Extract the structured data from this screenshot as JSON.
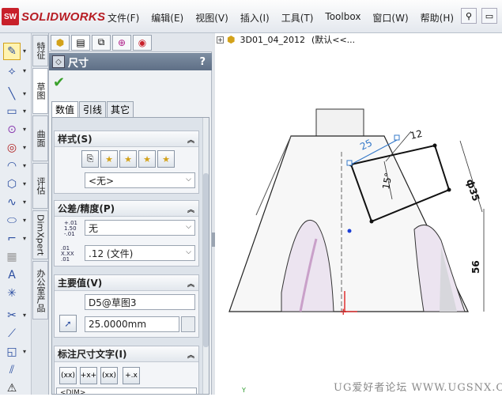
{
  "app": {
    "logo_badge": "SW",
    "logo_text": "SOLIDWORKS"
  },
  "menu": [
    "文件(F)",
    "编辑(E)",
    "视图(V)",
    "插入(I)",
    "工具(T)",
    "Toolbox",
    "窗口(W)",
    "帮助(H)"
  ],
  "vertical_tabs": [
    "特征",
    "草图",
    "曲面",
    "评估",
    "DimXpert",
    "办公室产品"
  ],
  "panel": {
    "title": "尺寸",
    "help": "?",
    "ok": "✔",
    "subtabs": [
      "数值",
      "引线",
      "其它"
    ],
    "style": {
      "title": "样式(S)",
      "value": "<无>"
    },
    "tolerance": {
      "title": "公差/精度(P)",
      "tol_label_top": "+.01",
      "tol_label_mid": "1.50",
      "tol_label_bot": "-.01",
      "tol_value": "无",
      "prec_label_top": ".01",
      "prec_label_mid": "X.XX",
      "prec_label_bot": ".01",
      "prec_value": ".12 (文件)"
    },
    "primary": {
      "title": "主要值(V)",
      "name": "D5@草图3",
      "value": "25.0000mm"
    },
    "dimtext": {
      "title": "标注尺寸文字(I)",
      "b1": "(xx)",
      "b2": "+x+",
      "b3": "(xx)",
      "b4": "+.x",
      "text": "<DIM>"
    }
  },
  "graphics": {
    "tree_item": "3D01_04_2012",
    "tree_config": "(默认<<...",
    "dims": {
      "d25": "25",
      "d12": "12",
      "d15": "15°",
      "dphi35": "ф35",
      "d56": "56"
    },
    "watermark": "UG爱好者论坛 WWW.UGSNX.COM",
    "axis_y": "Y"
  }
}
